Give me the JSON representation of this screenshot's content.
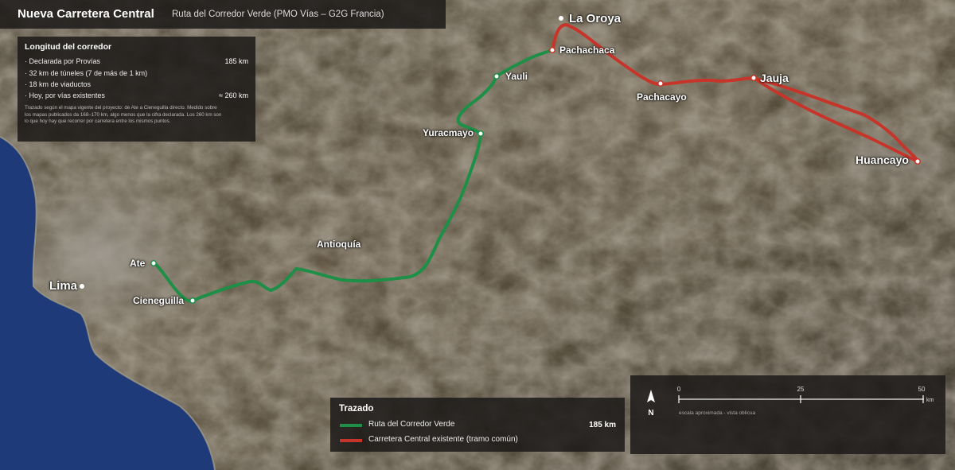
{
  "header": {
    "title": "Nueva Carretera Central",
    "subtitle": "Ruta del Corredor Verde (PMO Vías – G2G Francia)"
  },
  "length_panel": {
    "title": "Longitud del corredor",
    "items": [
      {
        "label": "·  Declarada por Provías",
        "value": "185 km"
      },
      {
        "label": "·  32 km de túneles (7 de más de 1 km)",
        "value": ""
      },
      {
        "label": "·  18 km de viaductos",
        "value": ""
      },
      {
        "label": "·  Hoy, por vías existentes",
        "value": "≈ 260 km"
      }
    ],
    "note": "Trazado según el mapa vigente del proyecto: de Ate a Cieneguilla directo. Medido sobre los mapas publicados da 168–170 km, algo menos que la cifra declarada. Los 260 km son lo que hoy hay que recorrer por carretera entre los mismos puntos."
  },
  "places": {
    "la_oroya": "La Oroya",
    "pachachaca": "Pachachaca",
    "jauja": "Jauja",
    "pachacayo": "Pachacayo",
    "yauli": "Yauli",
    "yuracmayo": "Yuracmayo",
    "huancayo": "Huancayo",
    "antioquia": "Antioquía",
    "ate": "Ate",
    "lima": "Lima",
    "cieneguilla": "Cieneguilla"
  },
  "legend": {
    "title": "Trazado",
    "items": [
      {
        "label": "Ruta del Corredor Verde",
        "value": "185 km",
        "color": "#1e8f46"
      },
      {
        "label": "Carretera Central existente (tramo común)",
        "value": "",
        "color": "#c7352a"
      }
    ]
  },
  "scale": {
    "north": "N",
    "ticks": [
      "0",
      "25",
      "50"
    ],
    "unit": "km",
    "caption": "escala aproximada - vista oblicua"
  },
  "colors": {
    "green_route": "#1e8f46",
    "red_route": "#c7352a",
    "ocean": "#1f3a78"
  }
}
